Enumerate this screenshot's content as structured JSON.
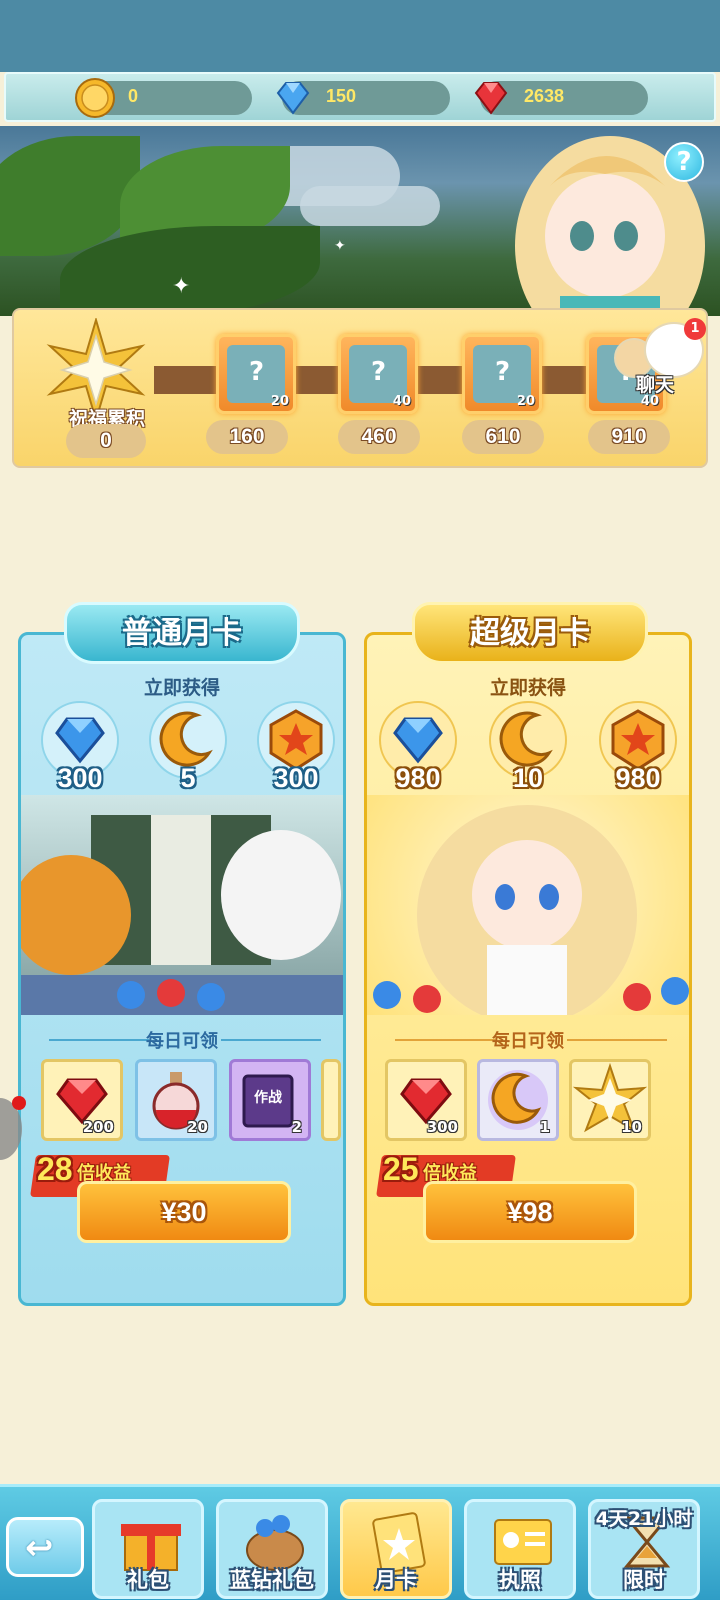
{
  "currency": {
    "gold": "0",
    "blue_diamond": "150",
    "red_diamond": "2638"
  },
  "blessing": {
    "label": "祝福累积",
    "value": "0",
    "milestones": [
      {
        "points": "160",
        "count": "20"
      },
      {
        "points": "460",
        "count": "40"
      },
      {
        "points": "610",
        "count": "20"
      },
      {
        "points": "910",
        "count": "40"
      }
    ]
  },
  "help": {
    "label": "?"
  },
  "chat": {
    "label": "聊天",
    "badge": "1"
  },
  "cards": {
    "normal": {
      "title": "普通月卡",
      "instant_label": "立即获得",
      "instant_items": [
        {
          "icon": "blue-diamond-icon",
          "amount": "300"
        },
        {
          "icon": "moon-icon",
          "amount": "5"
        },
        {
          "icon": "maple-badge-icon",
          "amount": "300"
        }
      ],
      "daily_label": "每日可领",
      "daily_items": [
        {
          "icon": "red-diamond-icon",
          "amount": "200"
        },
        {
          "icon": "potion-icon",
          "amount": "20"
        },
        {
          "icon": "battle-book-icon",
          "amount": "2",
          "book_text": "作战"
        }
      ],
      "bonus_multiplier": "28",
      "bonus_label": "倍收益",
      "price": "¥30"
    },
    "super": {
      "title": "超级月卡",
      "instant_label": "立即获得",
      "instant_items": [
        {
          "icon": "blue-diamond-icon",
          "amount": "980"
        },
        {
          "icon": "moon-icon",
          "amount": "10"
        },
        {
          "icon": "maple-badge-icon",
          "amount": "980"
        }
      ],
      "daily_label": "每日可领",
      "daily_items": [
        {
          "icon": "red-diamond-icon",
          "amount": "300"
        },
        {
          "icon": "moon-orb-icon",
          "amount": "1"
        },
        {
          "icon": "star-icon",
          "amount": "10"
        }
      ],
      "bonus_multiplier": "25",
      "bonus_label": "倍收益",
      "price": "¥98"
    }
  },
  "bottom_nav": {
    "tabs": [
      {
        "label": "礼包",
        "icon": "gift-box-icon"
      },
      {
        "label": "蓝钻礼包",
        "icon": "diamond-sack-icon"
      },
      {
        "label": "月卡",
        "icon": "month-card-icon",
        "active": true
      },
      {
        "label": "执照",
        "icon": "license-icon"
      },
      {
        "label": "限时",
        "icon": "hourglass-icon",
        "timer": "4天21小时"
      }
    ]
  },
  "colors": {
    "normal_card": "#49b7d2",
    "super_card": "#e8b41c",
    "price_button": "#f08a12",
    "bonus_badge": "#e33b25"
  }
}
